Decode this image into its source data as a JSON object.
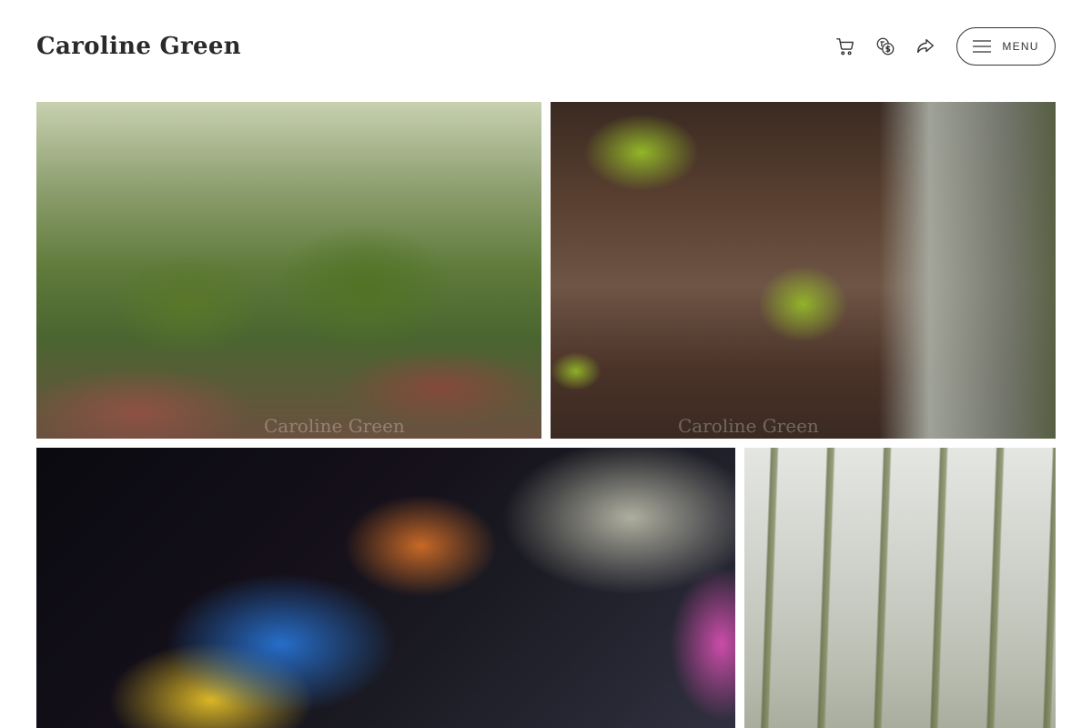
{
  "site": {
    "title": "Caroline Green"
  },
  "header": {
    "icons": [
      "cart-icon",
      "currency-icon",
      "share-icon",
      "hamburger-icon"
    ],
    "menu_label": "MENU"
  },
  "gallery": {
    "watermark": "Caroline Green",
    "tiles": [
      {
        "subject": "mossy-forest"
      },
      {
        "subject": "decaying-log-with-moss"
      },
      {
        "subject": "abstract-iridescent-macro"
      },
      {
        "subject": "ivy-covered-trees"
      }
    ]
  },
  "colors": {
    "text": "#2a2a2a",
    "button_border": "#333333",
    "background": "#ffffff"
  }
}
